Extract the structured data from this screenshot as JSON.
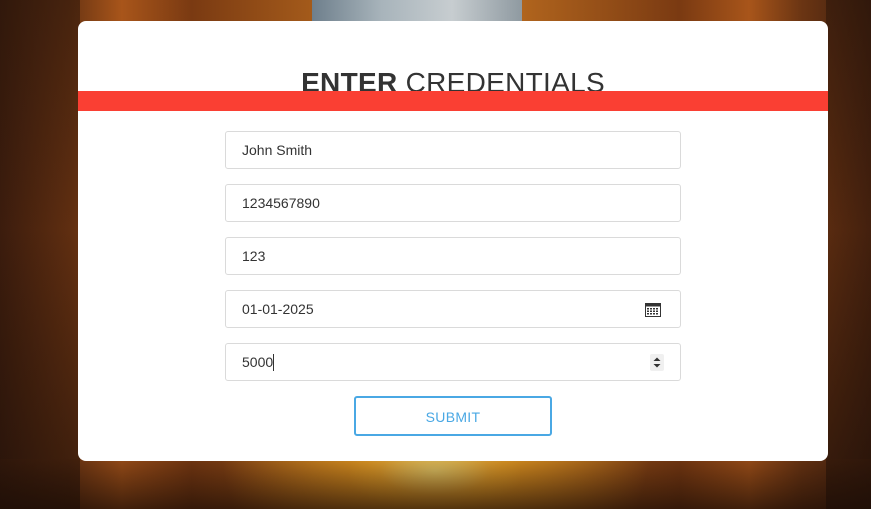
{
  "form": {
    "title_bold": "ENTER",
    "title_light": "CREDENTIALS",
    "fields": [
      {
        "value": "John Smith",
        "type": "text"
      },
      {
        "value": "1234567890",
        "type": "text"
      },
      {
        "value": "123",
        "type": "text"
      },
      {
        "value": "01-01-2025",
        "type": "date",
        "icon": "calendar-icon"
      },
      {
        "value": "5000",
        "type": "number",
        "icon": "spinner-icon"
      }
    ],
    "submit_label": "SUBMIT"
  },
  "colors": {
    "accent": "#fa3f33",
    "button": "#4aa8e4"
  }
}
